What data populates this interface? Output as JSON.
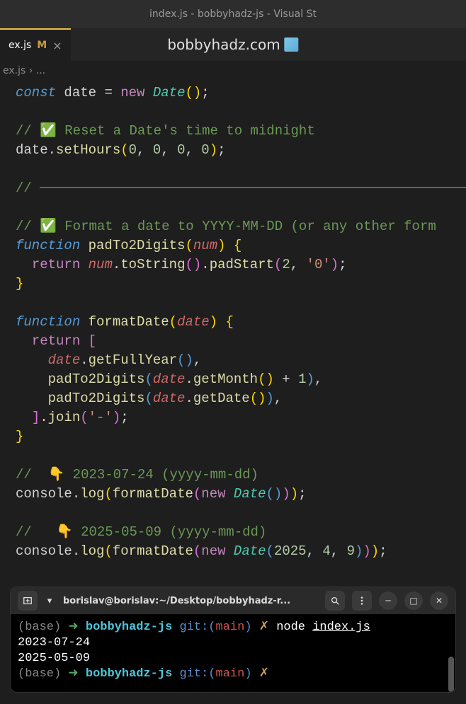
{
  "titleBar": "index.js - bobbyhadz-js - Visual St",
  "tab": {
    "name": "ex.js",
    "modified": "M",
    "close": "×"
  },
  "overlay": "bobbyhadz.com",
  "breadcrumb": "ex.js › ...",
  "code": {
    "const": "const",
    "date_var": "date",
    "eq": "=",
    "new": "new",
    "Date": "Date",
    "c1": "// ✅ Reset a Date's time to midnight",
    "setHours": "setHours",
    "n0a": "0",
    "n0b": "0",
    "n0c": "0",
    "n0d": "0",
    "c2": "// ───────────────────────────────────────────────────────",
    "c3": "// ✅ Format a date to YYYY-MM-DD (or any other form",
    "function": "function",
    "padTo2Digits": "padTo2Digits",
    "num_param": "num",
    "return": "return",
    "num_var": "num",
    "toString": "toString",
    "padStart": "padStart",
    "n2": "2",
    "str0": "'0'",
    "formatDate": "formatDate",
    "date_param": "date",
    "getFullYear": "getFullYear",
    "getMonth": "getMonth",
    "n1": "1",
    "plus": "+",
    "getDate": "getDate",
    "join": "join",
    "strDash": "'-'",
    "c4": "//  👇️ 2023-07-24 (yyyy-mm-dd)",
    "console": "console",
    "log": "log",
    "c5": "//   👇️ 2025-05-09 (yyyy-mm-dd)",
    "n2025": "2025",
    "n4": "4",
    "n9": "9"
  },
  "terminal": {
    "title": "borislav@borislav:~/Desktop/bobbyhadz-r...",
    "line1": {
      "base": "(base)",
      "arrow": "➜",
      "dir": "bobbyhadz-js",
      "git": "git:(",
      "branch": "main",
      "close": ")",
      "x": "✗",
      "cmd": "node",
      "file": "index.js"
    },
    "out1": "2023-07-24",
    "out2": "2025-05-09",
    "line2": {
      "base": "(base)",
      "arrow": "➜",
      "dir": "bobbyhadz-js",
      "git": "git:(",
      "branch": "main",
      "close": ")",
      "x": "✗"
    }
  }
}
